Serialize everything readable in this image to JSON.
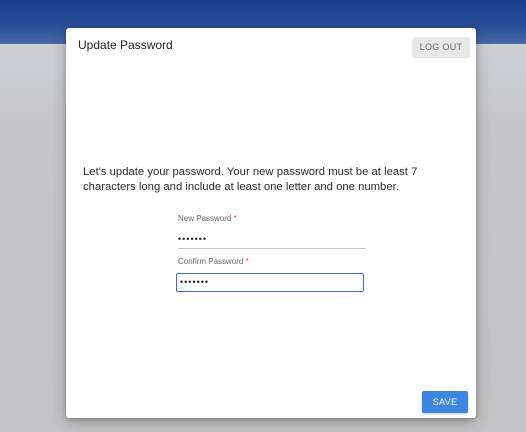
{
  "dialog": {
    "title": "Update Password",
    "logout_label": "LOG OUT",
    "message": "Let's update your password. Your new password must be at least 7 characters long and include at least one letter and one number.",
    "new_password": {
      "label": "New Password",
      "required_marker": "*",
      "value": "•••••••"
    },
    "confirm_password": {
      "label": "Confirm Password",
      "required_marker": "*",
      "value": "•••••••"
    },
    "save_label": "SAVE"
  },
  "colors": {
    "header_blue": "#1a3f8e",
    "accent_blue": "#3a86e0",
    "focus_border": "#3f6ad8",
    "required_red": "#e53935"
  }
}
